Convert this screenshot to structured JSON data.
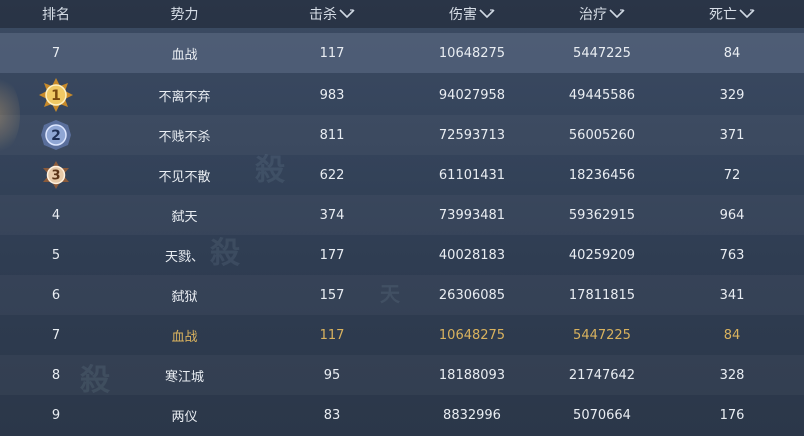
{
  "header": {
    "rank": "排名",
    "guild": "势力",
    "kills": "击杀",
    "damage": "伤害",
    "heal": "治疗",
    "deaths": "死亡"
  },
  "my_row": {
    "rank": "7",
    "guild": "血战",
    "kills": "117",
    "damage": "10648275",
    "heal": "5447225",
    "deaths": "84"
  },
  "rows": [
    {
      "rank": "1",
      "medal": "gold-medal-icon",
      "guild": "不离不弃",
      "kills": "983",
      "damage": "94027958",
      "heal": "49445586",
      "deaths": "329"
    },
    {
      "rank": "2",
      "medal": "silver-medal-icon",
      "guild": "不贱不杀",
      "kills": "811",
      "damage": "72593713",
      "heal": "56005260",
      "deaths": "371"
    },
    {
      "rank": "3",
      "medal": "bronze-medal-icon",
      "guild": "不见不散",
      "kills": "622",
      "damage": "61101431",
      "heal": "18236456",
      "deaths": "72"
    },
    {
      "rank": "4",
      "guild": "弑天",
      "kills": "374",
      "damage": "73993481",
      "heal": "59362915",
      "deaths": "964"
    },
    {
      "rank": "5",
      "guild": "天戮、",
      "kills": "177",
      "damage": "40028183",
      "heal": "40259209",
      "deaths": "763"
    },
    {
      "rank": "6",
      "guild": "弑狱",
      "kills": "157",
      "damage": "26306085",
      "heal": "17811815",
      "deaths": "341"
    },
    {
      "rank": "7",
      "guild": "血战",
      "kills": "117",
      "damage": "10648275",
      "heal": "5447225",
      "deaths": "84"
    },
    {
      "rank": "8",
      "guild": "寒江城",
      "kills": "95",
      "damage": "18188093",
      "heal": "21747642",
      "deaths": "328"
    },
    {
      "rank": "9",
      "guild": "两仪",
      "kills": "83",
      "damage": "8832996",
      "heal": "5070664",
      "deaths": "176"
    }
  ],
  "colors": {
    "highlight_text": "#d9b25e",
    "gold": "#e2b54a",
    "silver": "#8fa6d4",
    "bronze": "#c79a72"
  }
}
